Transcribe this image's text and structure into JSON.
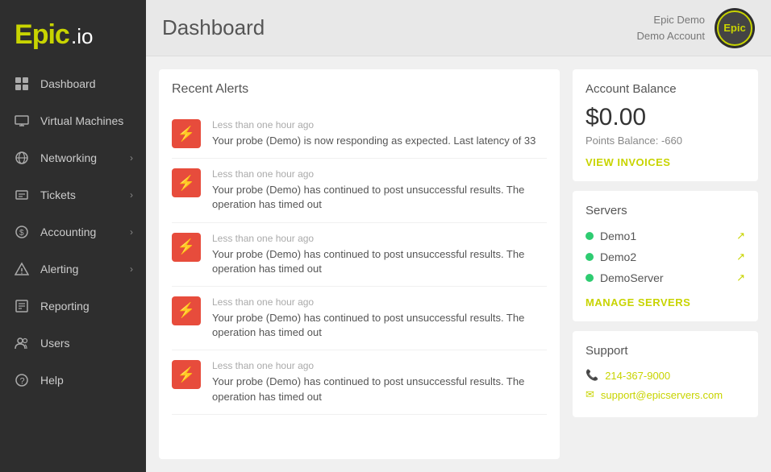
{
  "sidebar": {
    "logo": "Epic.io",
    "items": [
      {
        "id": "dashboard",
        "label": "Dashboard",
        "hasArrow": false
      },
      {
        "id": "virtual-machines",
        "label": "Virtual Machines",
        "hasArrow": false
      },
      {
        "id": "networking",
        "label": "Networking",
        "hasArrow": true
      },
      {
        "id": "tickets",
        "label": "Tickets",
        "hasArrow": true
      },
      {
        "id": "accounting",
        "label": "Accounting",
        "hasArrow": true
      },
      {
        "id": "alerting",
        "label": "Alerting",
        "hasArrow": true
      },
      {
        "id": "reporting",
        "label": "Reporting",
        "hasArrow": false
      },
      {
        "id": "users",
        "label": "Users",
        "hasArrow": false
      },
      {
        "id": "help",
        "label": "Help",
        "hasArrow": false
      }
    ]
  },
  "header": {
    "title": "Dashboard",
    "user_name": "Epic Demo",
    "account_name": "Demo Account"
  },
  "alerts": {
    "section_title": "Recent Alerts",
    "items": [
      {
        "time": "Less than one hour ago",
        "message": "Your probe (Demo) is now responding as expected. Last latency of 33"
      },
      {
        "time": "Less than one hour ago",
        "message": "Your probe (Demo) has continued to post unsuccessful results. The operation has timed out"
      },
      {
        "time": "Less than one hour ago",
        "message": "Your probe (Demo) has continued to post unsuccessful results. The operation has timed out"
      },
      {
        "time": "Less than one hour ago",
        "message": "Your probe (Demo) has continued to post unsuccessful results. The operation has timed out"
      },
      {
        "time": "Less than one hour ago",
        "message": "Your probe (Demo) has continued to post unsuccessful results. The operation has timed out"
      }
    ]
  },
  "account_balance": {
    "title": "Account Balance",
    "amount": "$0.00",
    "points_label": "Points Balance: -660",
    "view_invoices": "VIEW INVOICES"
  },
  "servers": {
    "title": "Servers",
    "items": [
      {
        "name": "Demo1",
        "status": "online"
      },
      {
        "name": "Demo2",
        "status": "online"
      },
      {
        "name": "DemoServer",
        "status": "online"
      }
    ],
    "manage_label": "MANAGE SERVERS"
  },
  "support": {
    "title": "Support",
    "phone": "214-367-9000",
    "email": "support@epicservers.com"
  }
}
